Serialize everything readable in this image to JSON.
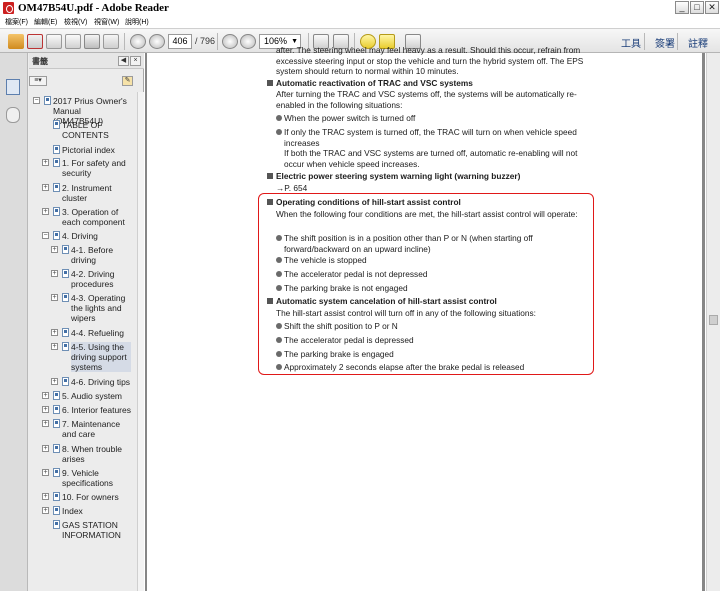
{
  "window": {
    "title": "OM47B54U.pdf - Adobe Reader",
    "buttons": {
      "minimize": "_",
      "maximize": "□",
      "close": "✕"
    }
  },
  "menu": [
    "檔案(F)",
    "編輯(E)",
    "檢視(V)",
    "視窗(W)",
    "說明(H)"
  ],
  "toolbar": {
    "page_current": "406",
    "page_total": "/ 796",
    "zoom": "106%",
    "tools_label": "工具",
    "sign_label": "簽署",
    "comment_label": "註釋"
  },
  "panel": {
    "header": "書籤",
    "bookmarks": [
      {
        "label": "2017 Prius Owner's Manual (OM47B54U)"
      },
      {
        "label": "TABLE OF CONTENTS"
      },
      {
        "label": "Pictorial index"
      },
      {
        "label": "1. For safety and security"
      },
      {
        "label": "2. Instrument cluster"
      },
      {
        "label": "3. Operation of each component"
      },
      {
        "label": "4. Driving"
      },
      {
        "label": "4-1. Before driving"
      },
      {
        "label": "4-2. Driving procedures"
      },
      {
        "label": "4-3. Operating the lights and wipers"
      },
      {
        "label": "4-4. Refueling"
      },
      {
        "label": "4-5. Using the driving support systems"
      },
      {
        "label": "4-6. Driving tips"
      },
      {
        "label": "5. Audio system"
      },
      {
        "label": "6. Interior features"
      },
      {
        "label": "7. Maintenance and care"
      },
      {
        "label": "8. When trouble arises"
      },
      {
        "label": "9. Vehicle specifications"
      },
      {
        "label": "10. For owners"
      },
      {
        "label": "Index"
      },
      {
        "label": "GAS STATION INFORMATION"
      }
    ]
  },
  "document": {
    "top_para": "after. The steering wheel may feel heavy as a result. Should this occur, refrain from excessive steering input or stop the vehicle and turn the hybrid system off. The EPS system should return to normal within 10 minutes.",
    "h1": "Automatic reactivation of TRAC and VSC systems",
    "p1": "After turning the TRAC and VSC systems off, the systems will be automatically re-enabled in the following situations:",
    "b1a": "When the power switch is turned off",
    "b1b": "If only the TRAC system is turned off, the TRAC will turn on when vehicle speed increases",
    "b1b_cont": "If both the TRAC and VSC systems are turned off, automatic re-enabling will not occur when vehicle speed increases.",
    "h2": "Electric power steering system warning light (warning buzzer)",
    "p2": "→P. 654",
    "h3": "Operating conditions of hill-start assist control",
    "p3": "When the following four conditions are met, the hill-start assist control will operate:",
    "b3a": "The shift position is in a position other than P or N (when starting off forward/backward on an upward incline)",
    "b3b": "The vehicle is stopped",
    "b3c": "The accelerator pedal is not depressed",
    "b3d": "The parking brake is not engaged",
    "h4": "Automatic system cancelation of hill-start assist control",
    "p4": "The hill-start assist control will turn off in any of the following situations:",
    "b4a": "Shift the shift position to P or N",
    "b4b": "The accelerator pedal is depressed",
    "b4c": "The parking brake is engaged",
    "b4d": "Approximately 2 seconds elapse after the brake pedal is released"
  },
  "colors": {
    "highlight_box": "#e01818",
    "doc_background": "#868686",
    "panel_background": "#ececec"
  }
}
